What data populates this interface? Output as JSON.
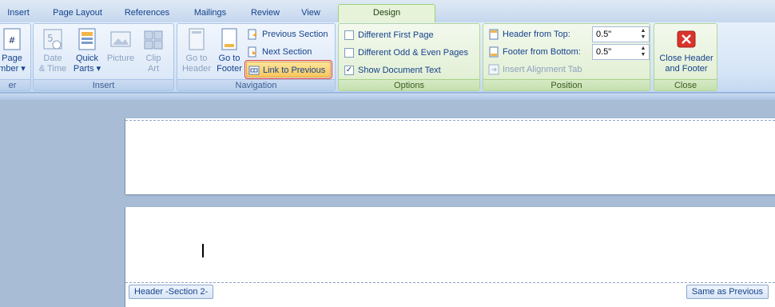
{
  "tabs": [
    {
      "label": "Insert"
    },
    {
      "label": "Page Layout"
    },
    {
      "label": "References"
    },
    {
      "label": "Mailings"
    },
    {
      "label": "Review"
    },
    {
      "label": "View"
    },
    {
      "label": "Design"
    }
  ],
  "groups": {
    "header_footer": {
      "title": "er",
      "page_number_1": "Page",
      "page_number_2": "mber"
    },
    "insert": {
      "title": "Insert",
      "date_time_1": "Date",
      "date_time_2": "& Time",
      "quick_parts_1": "Quick",
      "quick_parts_2": "Parts",
      "picture": "Picture",
      "clip_art_1": "Clip",
      "clip_art_2": "Art"
    },
    "navigation": {
      "title": "Navigation",
      "go_header_1": "Go to",
      "go_header_2": "Header",
      "go_footer_1": "Go to",
      "go_footer_2": "Footer",
      "previous_section": "Previous Section",
      "next_section": "Next Section",
      "link_to_previous": "Link to Previous"
    },
    "options": {
      "title": "Options",
      "different_first_page": "Different First Page",
      "different_odd_even": "Different Odd & Even Pages",
      "show_document_text": "Show Document Text",
      "different_first_page_checked": false,
      "different_odd_even_checked": false,
      "show_document_text_checked": true
    },
    "position": {
      "title": "Position",
      "header_from_top_label": "Header from Top:",
      "header_from_top_value": "0.5\"",
      "footer_from_bottom_label": "Footer from Bottom:",
      "footer_from_bottom_value": "0.5\"",
      "insert_alignment_tab": "Insert Alignment Tab"
    },
    "close": {
      "title": "Close",
      "close_header_footer_1": "Close Header",
      "close_header_footer_2": "and Footer"
    }
  },
  "document": {
    "header_tag": "Header -Section 2-",
    "same_as_previous": "Same as Previous"
  },
  "colors": {
    "design_tab": "#e6f3d9",
    "close_icon": "#d9342b",
    "highlight": "#f7c65c"
  }
}
